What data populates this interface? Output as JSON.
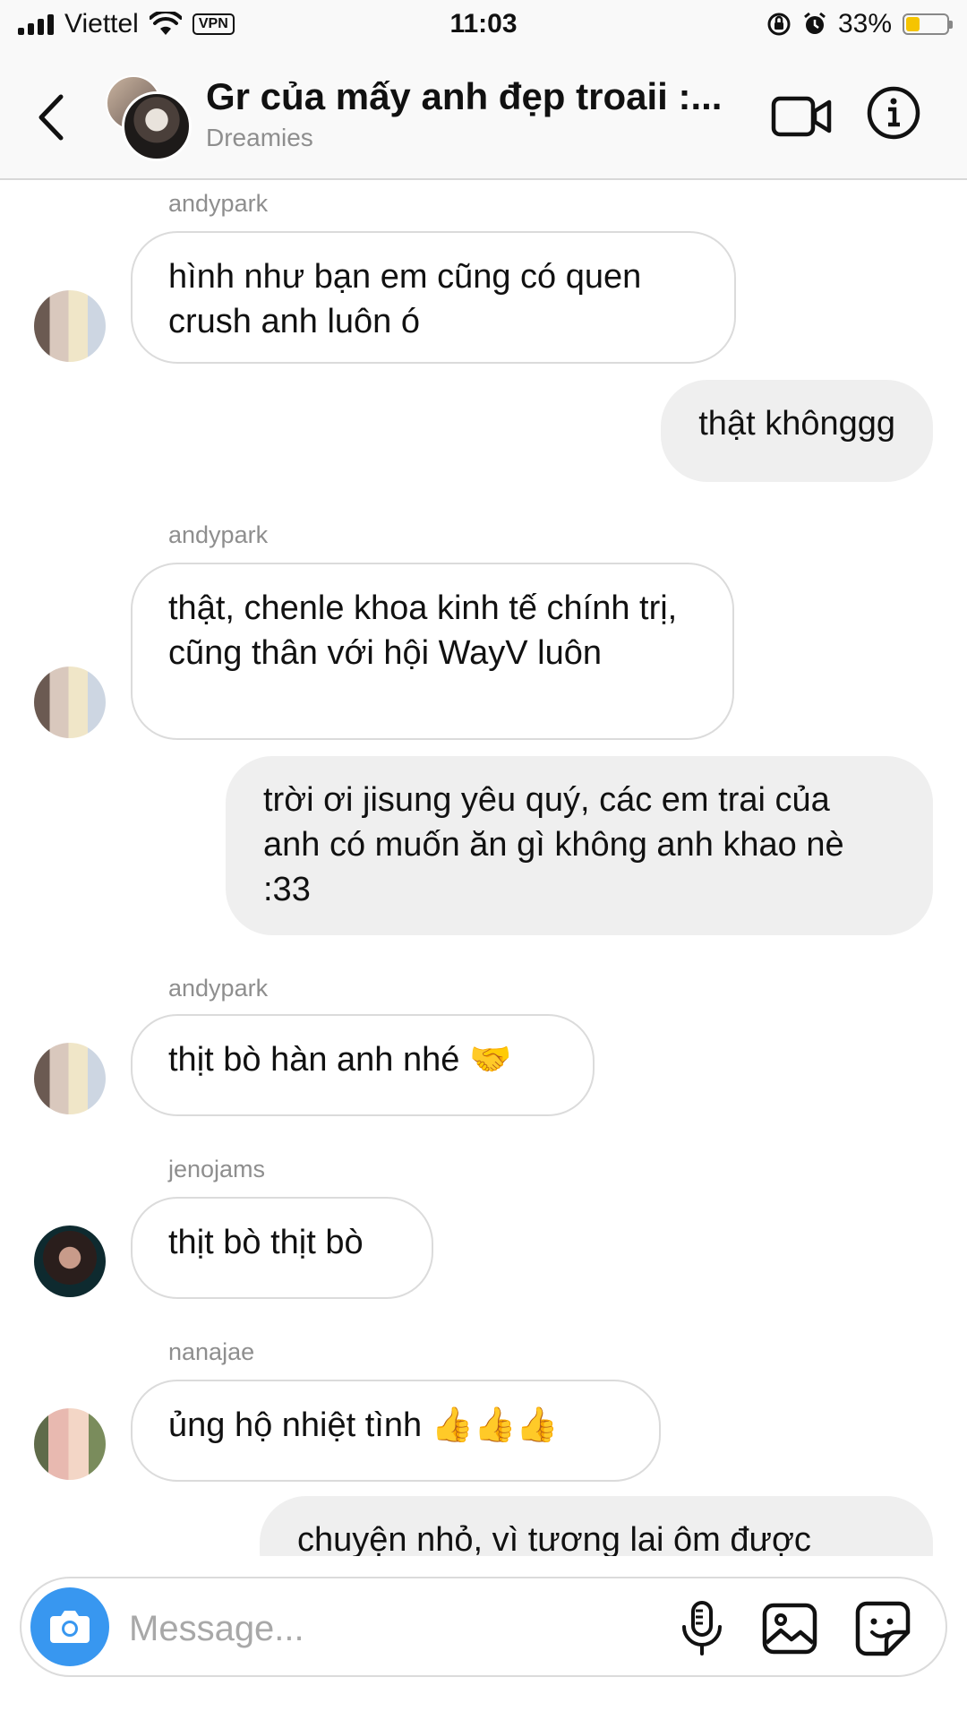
{
  "status_bar": {
    "carrier": "Viettel",
    "vpn": "VPN",
    "time": "11:03",
    "battery_percent": "33%",
    "battery_level": 0.33,
    "icons": [
      "signal-icon",
      "wifi-icon",
      "orientation-lock-icon",
      "alarm-icon",
      "battery-icon"
    ]
  },
  "header": {
    "title": "Gr của mấy anh đẹp troaii :...",
    "subtitle": "Dreamies",
    "icons": [
      "back-chevron-icon",
      "video-call-icon",
      "info-icon"
    ]
  },
  "messages": [
    {
      "sender": "andypark",
      "text": "hình như bạn em cũng có quen crush anh luôn ó"
    },
    {
      "outgoing": true,
      "text": "thật khônggg"
    },
    {
      "sender": "andypark",
      "text": "thật, chenle khoa kinh tế chính trị, cũng thân với hội WayV luôn"
    },
    {
      "outgoing": true,
      "text": "trời ơi jisung yêu quý, các em trai của anh có muốn ăn gì không anh khao nè :33"
    },
    {
      "sender": "andypark",
      "text": "thịt bò hàn anh nhé 🤝"
    },
    {
      "sender": "jenojams",
      "text": "thịt bò thịt bò"
    },
    {
      "sender": "nanajae",
      "text": "ủng hộ nhiệt tình 👍👍👍"
    },
    {
      "outgoing": true,
      "text": "chuyện nhỏ, vì tương lai ôm được"
    }
  ],
  "composer": {
    "placeholder": "Message...",
    "icons": [
      "camera-icon",
      "microphone-icon",
      "gallery-icon",
      "sticker-icon"
    ]
  },
  "colors": {
    "accent": "#3897f0",
    "outgoing_bubble": "#efefef",
    "incoming_border": "#dbdbdb",
    "muted_text": "#8e8e8e",
    "battery_fill": "#f5c400"
  }
}
